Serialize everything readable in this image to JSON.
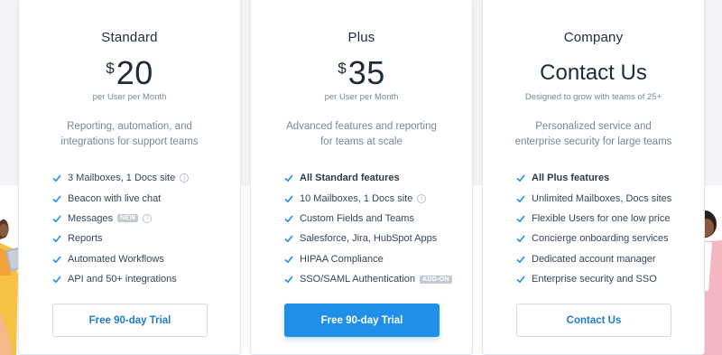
{
  "plans": [
    {
      "name": "Standard",
      "currency": "$",
      "amount": "20",
      "price_sub": "per User per Month",
      "desc_line1": "Reporting, automation, and",
      "desc_line2": "integrations for support teams",
      "features": [
        {
          "text": "3 Mailboxes, 1 Docs site"
        },
        {
          "text": "Beacon with live chat"
        },
        {
          "text": "Messages",
          "badge": "NEW"
        },
        {
          "text": "Reports"
        },
        {
          "text": "Automated Workflows"
        },
        {
          "text": "API and 50+ integrations"
        }
      ],
      "cta": "Free 90-day Trial"
    },
    {
      "name": "Plus",
      "currency": "$",
      "amount": "35",
      "price_sub": "per User per Month",
      "desc_line1": "Advanced features and reporting",
      "desc_line2": "for teams at scale",
      "features": [
        {
          "text": "All Standard features"
        },
        {
          "text": "10 Mailboxes, 1 Docs site"
        },
        {
          "text": "Custom Fields and Teams"
        },
        {
          "text": "Salesforce, Jira, HubSpot Apps"
        },
        {
          "text": "HIPAA Compliance"
        },
        {
          "text": "SSO/SAML Authentication",
          "badge": "ADD-ON"
        }
      ],
      "cta": "Free 90-day Trial"
    },
    {
      "name": "Company",
      "contact_title": "Contact Us",
      "price_sub": "Designed to grow with teams of 25+",
      "desc_line1": "Personalized service and",
      "desc_line2": "enterprise security for large teams",
      "features": [
        {
          "text": "All Plus features"
        },
        {
          "text": "Unlimited Mailboxes, Docs sites"
        },
        {
          "text": "Flexible Users for one low price"
        },
        {
          "text": "Concierge onboarding services"
        },
        {
          "text": "Dedicated account manager"
        },
        {
          "text": "Enterprise security and SSO"
        }
      ],
      "cta": "Contact Us"
    }
  ],
  "colors": {
    "accent": "#1f8fe8",
    "link": "#1f7ad1",
    "check": "#1f8fe8",
    "badge": "#c4cad3"
  },
  "icons": {
    "check": "check-icon",
    "info": "info-icon"
  }
}
